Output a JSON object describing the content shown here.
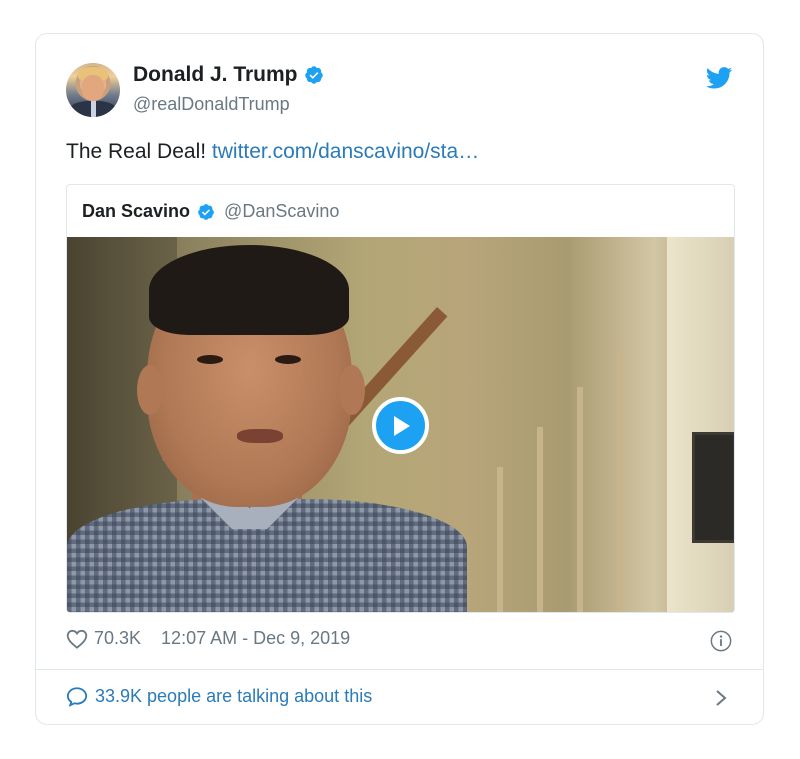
{
  "tweet": {
    "author": {
      "name": "Donald J. Trump",
      "handle": "@realDonaldTrump",
      "avatar_icon": "profile-photo",
      "verified": true
    },
    "text": "The Real Deal!",
    "link_text": "twitter.com/danscavino/sta…",
    "quoted": {
      "name": "Dan Scavino",
      "handle": "@DanScavino",
      "verified": true,
      "media": {
        "type": "video",
        "play_icon": "play-icon"
      }
    },
    "likes": "70.3K",
    "timestamp": "12:07 AM - Dec 9, 2019",
    "talking": "33.9K people are talking about this"
  },
  "icons": {
    "brand": "twitter-bird-icon",
    "verified": "verified-badge-icon",
    "like": "heart-icon",
    "info": "info-icon",
    "reply": "speech-bubble-icon",
    "more": "chevron-right-icon"
  },
  "colors": {
    "brand_blue": "#1da1f2",
    "link_blue": "#2b7bb9",
    "text_dark": "#1c2022",
    "text_muted": "#697882",
    "border": "#e1e8ed"
  }
}
